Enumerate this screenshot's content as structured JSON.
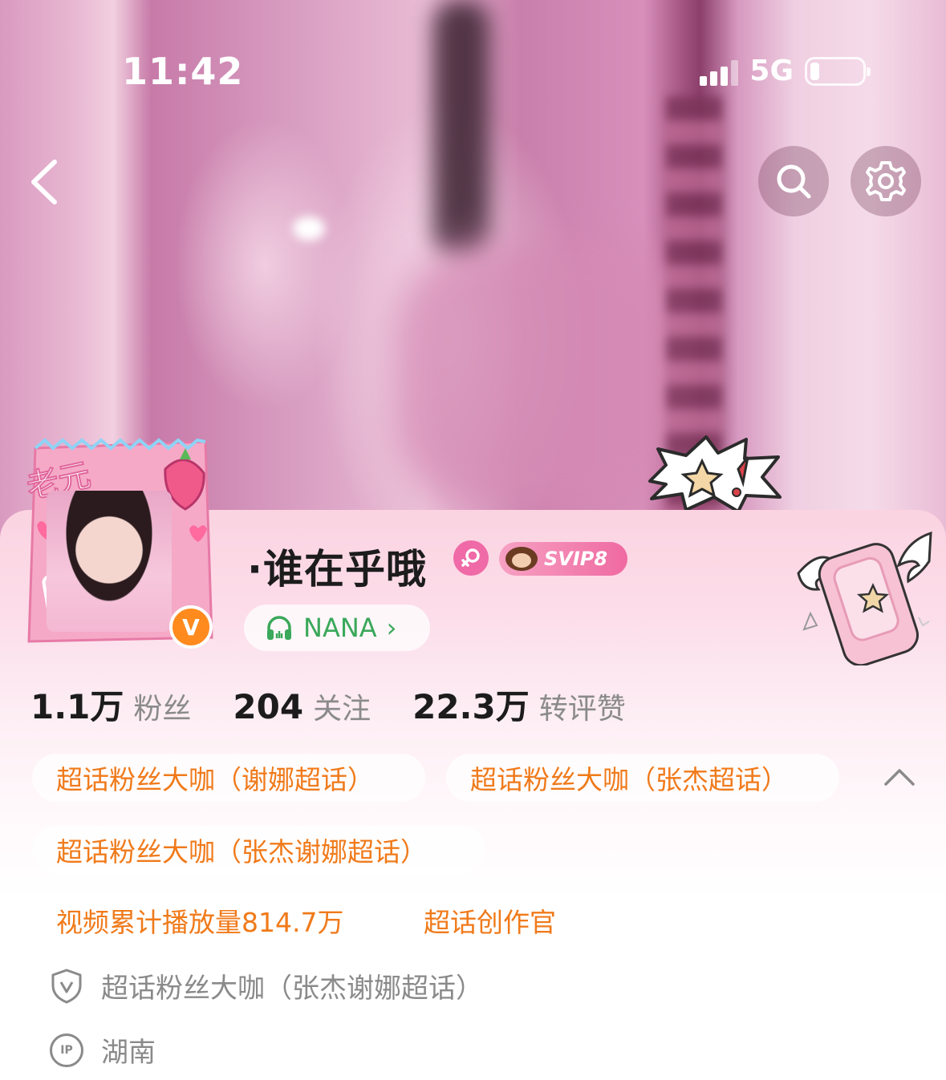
{
  "status_bar": {
    "time": "11:42",
    "network": "5G",
    "battery_level": 0.18
  },
  "header": {
    "back_icon": "chevron-left-icon",
    "search_icon": "search-icon",
    "settings_icon": "gear-icon"
  },
  "profile": {
    "username": "·谁在乎哦",
    "gender_icon": "female-icon",
    "vip_badge": "SVIP8",
    "verified_badge": "V",
    "music": {
      "icon": "headphones-icon",
      "label": "NANA",
      "chevron": "›"
    }
  },
  "stats": [
    {
      "value": "1.1万",
      "label": "粉丝"
    },
    {
      "value": "204",
      "label": "关注"
    },
    {
      "value": "22.3万",
      "label": "转评赞"
    }
  ],
  "tags": [
    "超话粉丝大咖（谢娜超话）",
    "超话粉丝大咖（张杰超话）",
    "超话粉丝大咖（张杰谢娜超话）"
  ],
  "highlights": [
    "视频累计播放量814.7万",
    "超话创作官"
  ],
  "info": {
    "verification": "超话粉丝大咖（张杰谢娜超话）",
    "ip_badge": "IP",
    "location": "湖南"
  },
  "colors": {
    "accent_orange": "#f07a1a",
    "music_green": "#3aa85a",
    "verify_orange": "#ff8a1e",
    "gender_pink": "#ef6aa7"
  }
}
